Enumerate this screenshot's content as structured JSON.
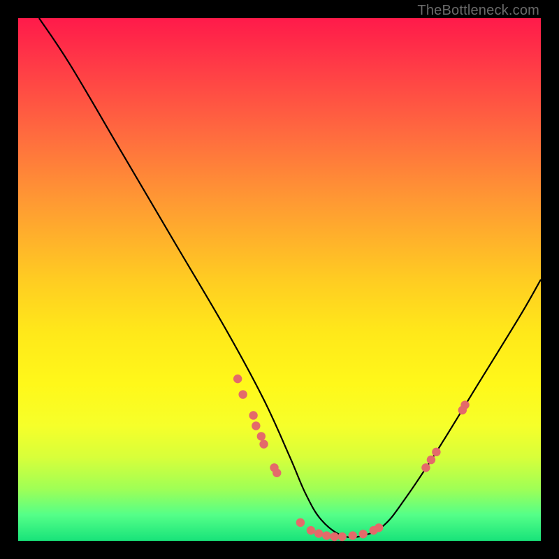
{
  "attribution": "TheBottleneck.com",
  "palette": {
    "background": "#000000",
    "gradient_top": "#ff1a4a",
    "gradient_bottom": "#18e37a",
    "curve": "#000000",
    "dot": "#e46a6a"
  },
  "chart_data": {
    "type": "line",
    "title": "",
    "xlabel": "",
    "ylabel": "",
    "xlim": [
      0,
      100
    ],
    "ylim": [
      0,
      100
    ],
    "grid": false,
    "description": "Bottleneck curve: vertical axis is bottleneck percentage (high at top = red, 0 at bottom = green). Curve drops from upper-left to a zero-bottleneck trough around x≈55–70, then rises toward the right. Pink dots are sample configurations.",
    "series": [
      {
        "name": "bottleneck-curve",
        "x": [
          4,
          10,
          20,
          30,
          40,
          47,
          52,
          55,
          58,
          62,
          66,
          70,
          74,
          80,
          88,
          96,
          100
        ],
        "y": [
          100,
          91,
          74,
          57,
          40,
          27,
          16,
          9,
          4,
          1,
          1,
          3,
          8,
          17,
          30,
          43,
          50
        ]
      }
    ],
    "points": [
      {
        "x": 42,
        "y": 31
      },
      {
        "x": 43,
        "y": 28
      },
      {
        "x": 45,
        "y": 24
      },
      {
        "x": 45.5,
        "y": 22
      },
      {
        "x": 46.5,
        "y": 20
      },
      {
        "x": 47,
        "y": 18.5
      },
      {
        "x": 49,
        "y": 14
      },
      {
        "x": 49.5,
        "y": 13
      },
      {
        "x": 54,
        "y": 3.5
      },
      {
        "x": 56,
        "y": 2
      },
      {
        "x": 57.5,
        "y": 1.4
      },
      {
        "x": 59,
        "y": 1
      },
      {
        "x": 60.5,
        "y": 0.8
      },
      {
        "x": 62,
        "y": 0.8
      },
      {
        "x": 64,
        "y": 1
      },
      {
        "x": 66,
        "y": 1.3
      },
      {
        "x": 68,
        "y": 2
      },
      {
        "x": 69,
        "y": 2.5
      },
      {
        "x": 78,
        "y": 14
      },
      {
        "x": 79,
        "y": 15.5
      },
      {
        "x": 80,
        "y": 17
      },
      {
        "x": 85,
        "y": 25
      },
      {
        "x": 85.5,
        "y": 26
      }
    ]
  }
}
